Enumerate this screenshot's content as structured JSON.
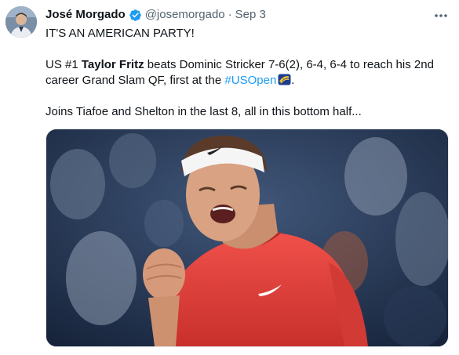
{
  "author": {
    "name": "José Morgado",
    "handle": "@josemorgado",
    "separator": "·",
    "date": "Sep 3",
    "more_icon": "more-horizontal-icon",
    "verified_icon": "verified-badge-icon"
  },
  "tweet": {
    "line1": "IT'S AN AMERICAN PARTY!",
    "line2_a": "US #1 ",
    "line2_bold": "Taylor Fritz",
    "line2_b": " beats Dominic Stricker 7-6(2), 6-4, 6-4 to reach his 2nd",
    "line3_a": "career Grand Slam QF, first at the ",
    "hashtag": "#USOpen",
    "line3_end": ".",
    "line4": "Joins Tiafoe and Shelton in the last 8, all in this bottom half..."
  },
  "colors": {
    "link": "#1d9bf0",
    "secondary_text": "#536471",
    "shirt": "#e8413c",
    "headband": "#f5f5f5"
  }
}
